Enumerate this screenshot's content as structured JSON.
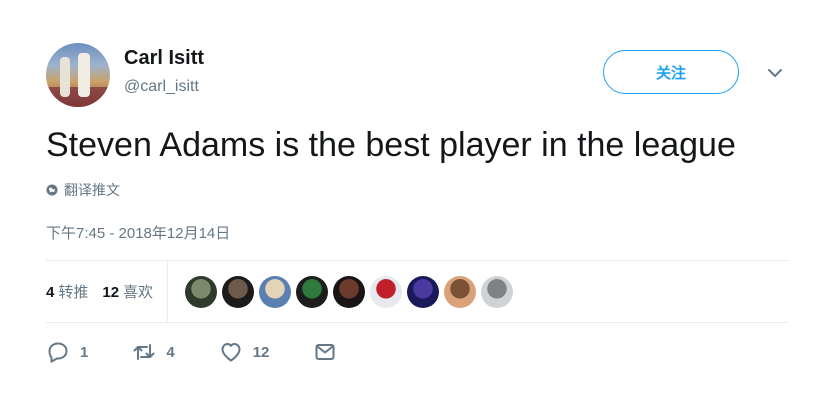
{
  "user": {
    "name": "Carl Isitt",
    "handle": "@carl_isitt"
  },
  "follow_label": "关注",
  "tweet": {
    "text": "Steven Adams is the best player in the league",
    "translate_label": "翻译推文",
    "timestamp": "下午7:45 - 2018年12月14日"
  },
  "stats": {
    "retweets_count": "4",
    "retweets_label": "转推",
    "likes_count": "12",
    "likes_label": "喜欢"
  },
  "liker_avatars": [
    {
      "name": "liker-avatar-1",
      "colors": [
        "#2f3a2c",
        "#7d8a6a"
      ]
    },
    {
      "name": "liker-avatar-2",
      "colors": [
        "#1b1b1b",
        "#6e5a4a"
      ]
    },
    {
      "name": "liker-avatar-3",
      "colors": [
        "#5b7fb0",
        "#e3d4b8"
      ]
    },
    {
      "name": "liker-avatar-4",
      "colors": [
        "#1d1d1d",
        "#2f7a3d"
      ]
    },
    {
      "name": "liker-avatar-5",
      "colors": [
        "#1a1416",
        "#6b3b2d"
      ]
    },
    {
      "name": "liker-avatar-6",
      "colors": [
        "#e8e8ee",
        "#c0202a"
      ]
    },
    {
      "name": "liker-avatar-7",
      "colors": [
        "#1a1a5a",
        "#4a3aa0"
      ]
    },
    {
      "name": "liker-avatar-8",
      "colors": [
        "#d9a27a",
        "#7a5235"
      ]
    },
    {
      "name": "liker-avatar-9",
      "colors": [
        "#cfd3d6",
        "#7d8286"
      ]
    }
  ],
  "actions": {
    "reply_count": "1",
    "retweet_count": "4",
    "like_count": "12"
  },
  "colors": {
    "accent": "#1da1f2",
    "secondary_text": "#657786",
    "primary_text": "#14171a",
    "divider": "#e6ecf0"
  }
}
